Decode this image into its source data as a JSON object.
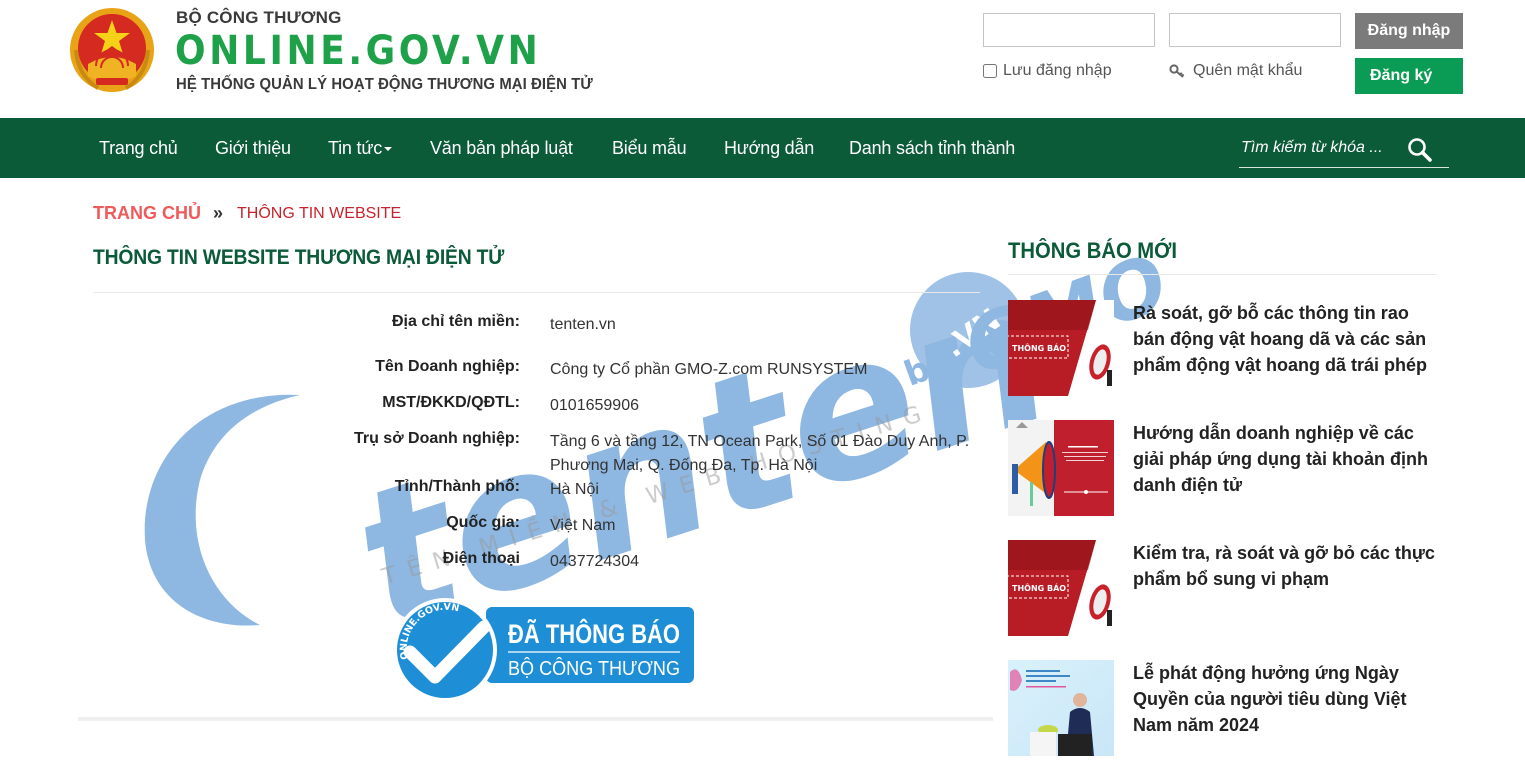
{
  "header": {
    "ministry": "BỘ CÔNG THƯƠNG",
    "site_name": "ONLINE.GOV.VN",
    "system_name": "HỆ THỐNG QUẢN LÝ HOẠT ĐỘNG THƯƠNG MẠI ĐIỆN TỬ",
    "login": {
      "username_value": "",
      "password_value": "",
      "login_label": "Đăng nhập",
      "register_label": "Đăng ký",
      "remember_label": "Lưu đăng nhập",
      "remember_checked": false,
      "forgot_label": "Quên mật khẩu"
    }
  },
  "nav": {
    "items": [
      {
        "label": "Trang chủ"
      },
      {
        "label": "Giới thiệu"
      },
      {
        "label": "Tin tức",
        "has_dropdown": true
      },
      {
        "label": "Văn bản pháp luật"
      },
      {
        "label": "Biểu mẫu"
      },
      {
        "label": "Hướng dẫn"
      },
      {
        "label": "Danh sách tỉnh thành"
      }
    ],
    "search_placeholder": "Tìm kiếm từ khóa ...",
    "search_icon": "search-icon"
  },
  "breadcrumb": {
    "home": "TRANG CHỦ",
    "separator": "»",
    "current": "THÔNG TIN WEBSITE"
  },
  "main": {
    "title": "THÔNG TIN WEBSITE THƯƠNG MẠI ĐIỆN TỬ",
    "fields": [
      {
        "label": "Địa chỉ tên miền:",
        "value": "tenten.vn"
      },
      {
        "label": "Tên Doanh nghiệp:",
        "value": "Công ty Cổ phần GMO-Z.com RUNSYSTEM"
      },
      {
        "label": "MST/ĐKKD/QĐTL:",
        "value": "0101659906"
      },
      {
        "label": "Trụ sở Doanh nghiệp:",
        "value": "Tầng 6 và tầng 12, TN Ocean Park, Số 01 Đào Duy Anh, P. Phương Mai, Q. Đống Đa, Tp. Hà Nội"
      },
      {
        "label": "Tỉnh/Thành phố:",
        "value": "Hà Nội"
      },
      {
        "label": "Quốc gia:",
        "value": "Việt Nam"
      },
      {
        "label": "Điện thoại",
        "value": "0437724304"
      }
    ],
    "badge": {
      "ring_text": "ONLINE.GOV.VN",
      "line1": "ĐÃ THÔNG BÁO",
      "line2": "BỘ CÔNG THƯƠNG"
    }
  },
  "sidebar": {
    "title": "THÔNG BÁO MỚI",
    "thumb_label": "THÔNG BÁO",
    "items": [
      {
        "title": "Rà soát, gỡ bỗ các thông tin rao bán động vật hoang dã và các sản phẩm động vật hoang dã trái phép"
      },
      {
        "title": "Hướng dẫn doanh nghiệp về các giải pháp ứng dụng tài khoản định danh điện tử"
      },
      {
        "title": "Kiểm tra, rà soát và gỡ bỏ các thực phẩm bổ sung vi phạm"
      },
      {
        "title": "Lễ phát động hưởng ứng Ngày Quyền của người tiêu dùng Việt Nam năm 2024"
      }
    ]
  },
  "watermark": {
    "brand": "tenten",
    "suffix": ".VN",
    "by": "by",
    "company": "GMO",
    "tagline": "TÊN MIỀN & WEB HOSTING"
  },
  "colors": {
    "nav_bg": "#0b5a38",
    "brand_green": "#1fa14a",
    "register_green": "#0a9c54",
    "login_gray": "#7b7b7b",
    "breadcrumb_home": "#ef5a5a",
    "breadcrumb_current": "#c8232c",
    "badge_blue": "#1e8fd6",
    "watermark_blue": "#4a8ccf"
  }
}
